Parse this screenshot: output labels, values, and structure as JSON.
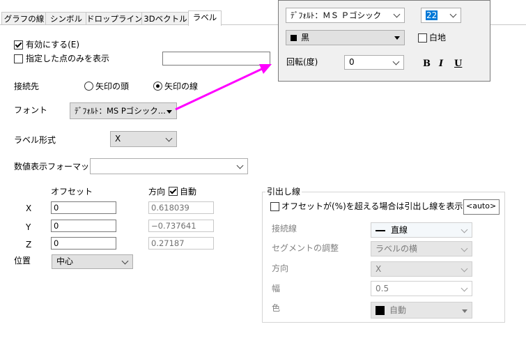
{
  "tabs": [
    "グラフの線",
    "シンボル",
    "ドロップライン",
    "3Dベクトル",
    "ラベル"
  ],
  "enable_label": "有効にする(E)",
  "show_selected_only": "指定した点のみを表示",
  "connect_to": {
    "label": "接続先",
    "option_head": "矢印の頭",
    "option_line": "矢印の線",
    "selected": "矢印の線"
  },
  "font": {
    "label": "フォント",
    "value": "ﾃﾞﾌｫﾙﾄ：MS Pゴシック..."
  },
  "label_format": {
    "label": "ラベル形式",
    "value": "X"
  },
  "number_format": {
    "label": "数値表示フォーマット",
    "value": ""
  },
  "offset": {
    "header": "オフセット",
    "dir_header": "方向",
    "auto_label": "自動",
    "auto_checked": true,
    "rows": [
      {
        "axis": "X",
        "offset": "0",
        "direction": "0.618039"
      },
      {
        "axis": "Y",
        "offset": "0",
        "direction": "−0.737641"
      },
      {
        "axis": "Z",
        "offset": "0",
        "direction": "0.27187"
      }
    ]
  },
  "position": {
    "label": "位置",
    "value": "中心"
  },
  "leader": {
    "title": "引出し線",
    "threshold_label": "オフセットが(%)を超える場合は引出し線を表示",
    "threshold_value": "<auto>",
    "connector_label": "接続線",
    "connector_value": "直線",
    "segment_label": "セグメントの調整",
    "segment_value": "ラベルの横",
    "direction_label": "方向",
    "direction_value": "X",
    "width_label": "幅",
    "width_value": "0.5",
    "color_label": "色",
    "color_value": "自動"
  },
  "popup": {
    "font_value": "ﾃﾞﾌｫﾙﾄ：ＭＳ Ｐゴシック",
    "size_value": "22",
    "color_value": "黒",
    "white_bg_label": "白地",
    "rotation_label": "回転(度)",
    "rotation_value": "0",
    "bold": "B",
    "italic": "I",
    "underline": "U"
  },
  "colors": {
    "arrow": "#ff00ff",
    "selection": "#0078d7"
  }
}
